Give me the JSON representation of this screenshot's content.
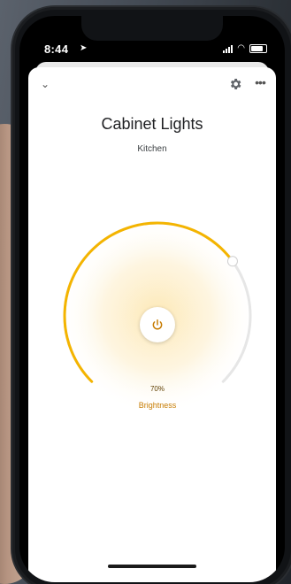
{
  "status_bar": {
    "time": "8:44",
    "location_icon": "location-arrow-icon",
    "signal_icon": "cellular-signal-icon",
    "wifi_icon": "wifi-icon",
    "battery_icon": "battery-icon"
  },
  "header": {
    "collapse_icon": "chevron-down-icon",
    "settings_icon": "gear-icon",
    "more_icon": "more-horizontal-icon"
  },
  "device": {
    "name": "Cabinet Lights",
    "room": "Kitchen"
  },
  "brightness": {
    "value_text": "70%",
    "label": "Brightness",
    "level": 0.7
  },
  "colors": {
    "accent": "#f4b400",
    "label_accent": "#c77c02",
    "track": "#e6e6e6",
    "glow": "#fde7b1"
  }
}
